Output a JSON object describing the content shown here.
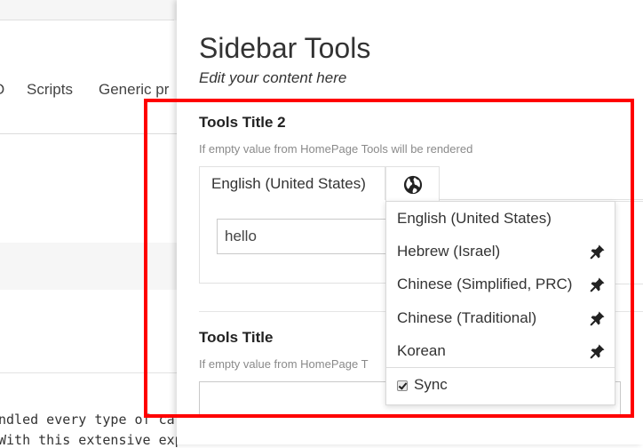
{
  "background": {
    "tabs": [
      "O",
      "Scripts",
      "Generic pr"
    ],
    "text_lines": [
      "ndled every type of car",
      "With this extensive expe"
    ]
  },
  "panel": {
    "title": "Sidebar Tools",
    "subtitle": "Edit your content here"
  },
  "field1": {
    "title": "Tools Title 2",
    "help": "If empty value from HomePage Tools will be rendered",
    "active_language": "English (United States)",
    "globe_icon": "globe-icon",
    "value": "hello"
  },
  "field2": {
    "title": "Tools Title",
    "help": "If empty value from HomePage T",
    "value": ""
  },
  "language_menu": {
    "items": [
      {
        "label": "English (United States)",
        "pinned": false
      },
      {
        "label": "Hebrew (Israel)",
        "pinned": true
      },
      {
        "label": "Chinese (Simplified, PRC)",
        "pinned": true
      },
      {
        "label": "Chinese (Traditional)",
        "pinned": true
      },
      {
        "label": "Korean",
        "pinned": true
      }
    ],
    "sync_label": "Sync",
    "sync_checked": true
  },
  "colors": {
    "highlight": "#ff0000",
    "help_text": "#8a8a8a"
  }
}
